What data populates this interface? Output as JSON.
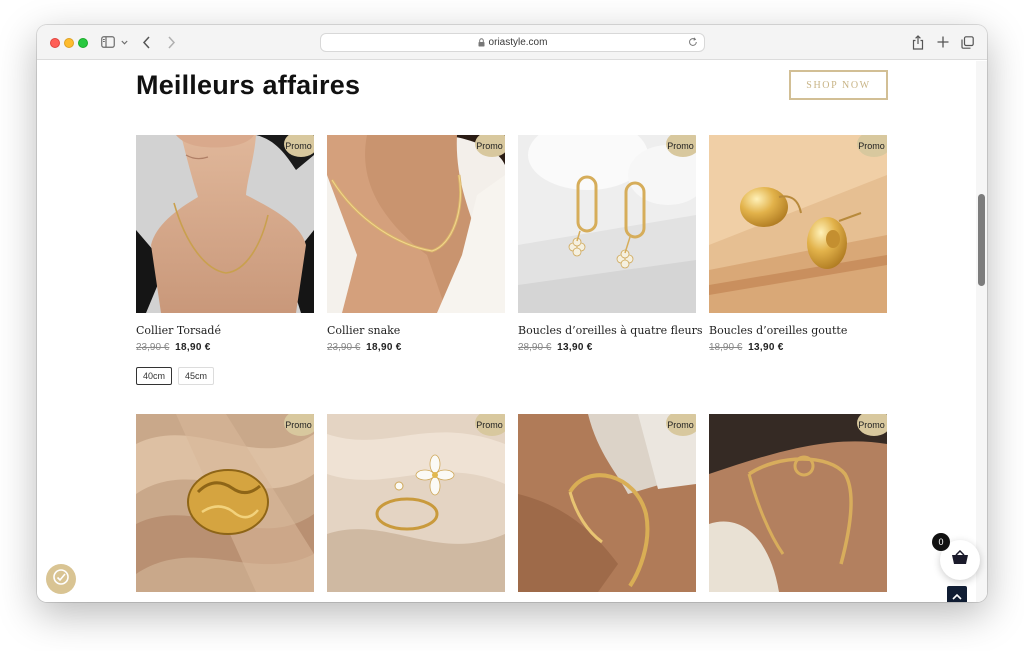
{
  "browser": {
    "url": "oriastyle.com"
  },
  "page": {
    "title": "Meilleurs affaires",
    "shop_now_label": "SHOP NOW",
    "promo_label": "Promo !"
  },
  "products": [
    {
      "name": "Collier Torsadé",
      "old_price": "23,90 €",
      "new_price": "18,90 €",
      "sizes": [
        "40cm",
        "45cm"
      ]
    },
    {
      "name": "Collier snake",
      "old_price": "23,90 €",
      "new_price": "18,90 €"
    },
    {
      "name": "Boucles d’oreilles à quatre fleurs",
      "old_price": "28,90 €",
      "new_price": "13,90 €"
    },
    {
      "name": "Boucles d’oreilles goutte",
      "old_price": "18,90 €",
      "new_price": "13,90 €"
    }
  ],
  "cart": {
    "count": "0"
  },
  "colors": {
    "accent": "#d2bf95",
    "promo": "#d8c89e",
    "back_to_top": "#101d33"
  },
  "icons": [
    "sidebar-icon",
    "chevron-down-icon",
    "back-icon",
    "forward-icon",
    "lock-icon",
    "reload-icon",
    "share-icon",
    "plus-icon",
    "tabs-icon",
    "cart-icon",
    "arrow-up-icon",
    "accessibility-icon"
  ]
}
